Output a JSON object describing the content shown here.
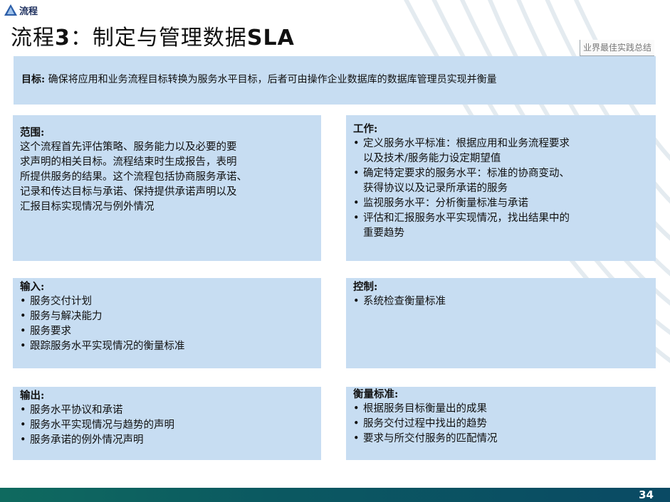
{
  "logo": {
    "text": "流程",
    "icon": "triangle-logo-icon"
  },
  "title": {
    "prefix": "流程",
    "number": "3",
    "rest": "：制定与管理数据",
    "suffix": "SLA"
  },
  "tag": "业界最佳实践总结",
  "goal": {
    "label": "目标:",
    "text": "确保将应用和业务流程目标转换为服务水平目标，后者可由操作企业数据库的数据库管理员实现并衡量"
  },
  "scope": {
    "heading": "范围:",
    "lines": [
      "这个流程首先评估策略、服务能力以及必要的要",
      "求声明的相关目标。流程结束时生成报告，表明",
      "所提供服务的结果。这个流程包括协商服务承诺、",
      "记录和传达目标与承诺、保持提供承诺声明以及",
      "汇报目标实现情况与例外情况"
    ]
  },
  "work": {
    "heading": "工作:",
    "items": [
      [
        "定义服务水平标准：根据应用和业务流程要求",
        "以及技术/服务能力设定期望值"
      ],
      [
        "确定特定要求的服务水平：标准的协商变动、",
        "获得协议以及记录所承诺的服务"
      ],
      [
        "监视服务水平：分析衡量标准与承诺"
      ],
      [
        "评估和汇报服务水平实现情况，找出结果中的",
        "重要趋势"
      ]
    ]
  },
  "input": {
    "heading": "输入:",
    "items": [
      "服务交付计划",
      "服务与解决能力",
      "服务要求",
      "跟踪服务水平实现情况的衡量标准"
    ]
  },
  "control": {
    "heading": "控制:",
    "items": [
      "系统检查衡量标准"
    ]
  },
  "output": {
    "heading": "输出:",
    "items": [
      "服务水平协议和承诺",
      "服务水平实现情况与趋势的声明",
      "服务承诺的例外情况声明"
    ]
  },
  "measure": {
    "heading": "衡量标准:",
    "items": [
      "根据服务目标衡量出的成果",
      "服务交付过程中找出的趋势",
      "要求与所交付服务的匹配情况"
    ]
  },
  "footer": {
    "page": "34"
  },
  "colors": {
    "box": "#c7ddf2",
    "footer": "#0b5961",
    "title": "#111111",
    "logo": "#1d2f5e"
  }
}
